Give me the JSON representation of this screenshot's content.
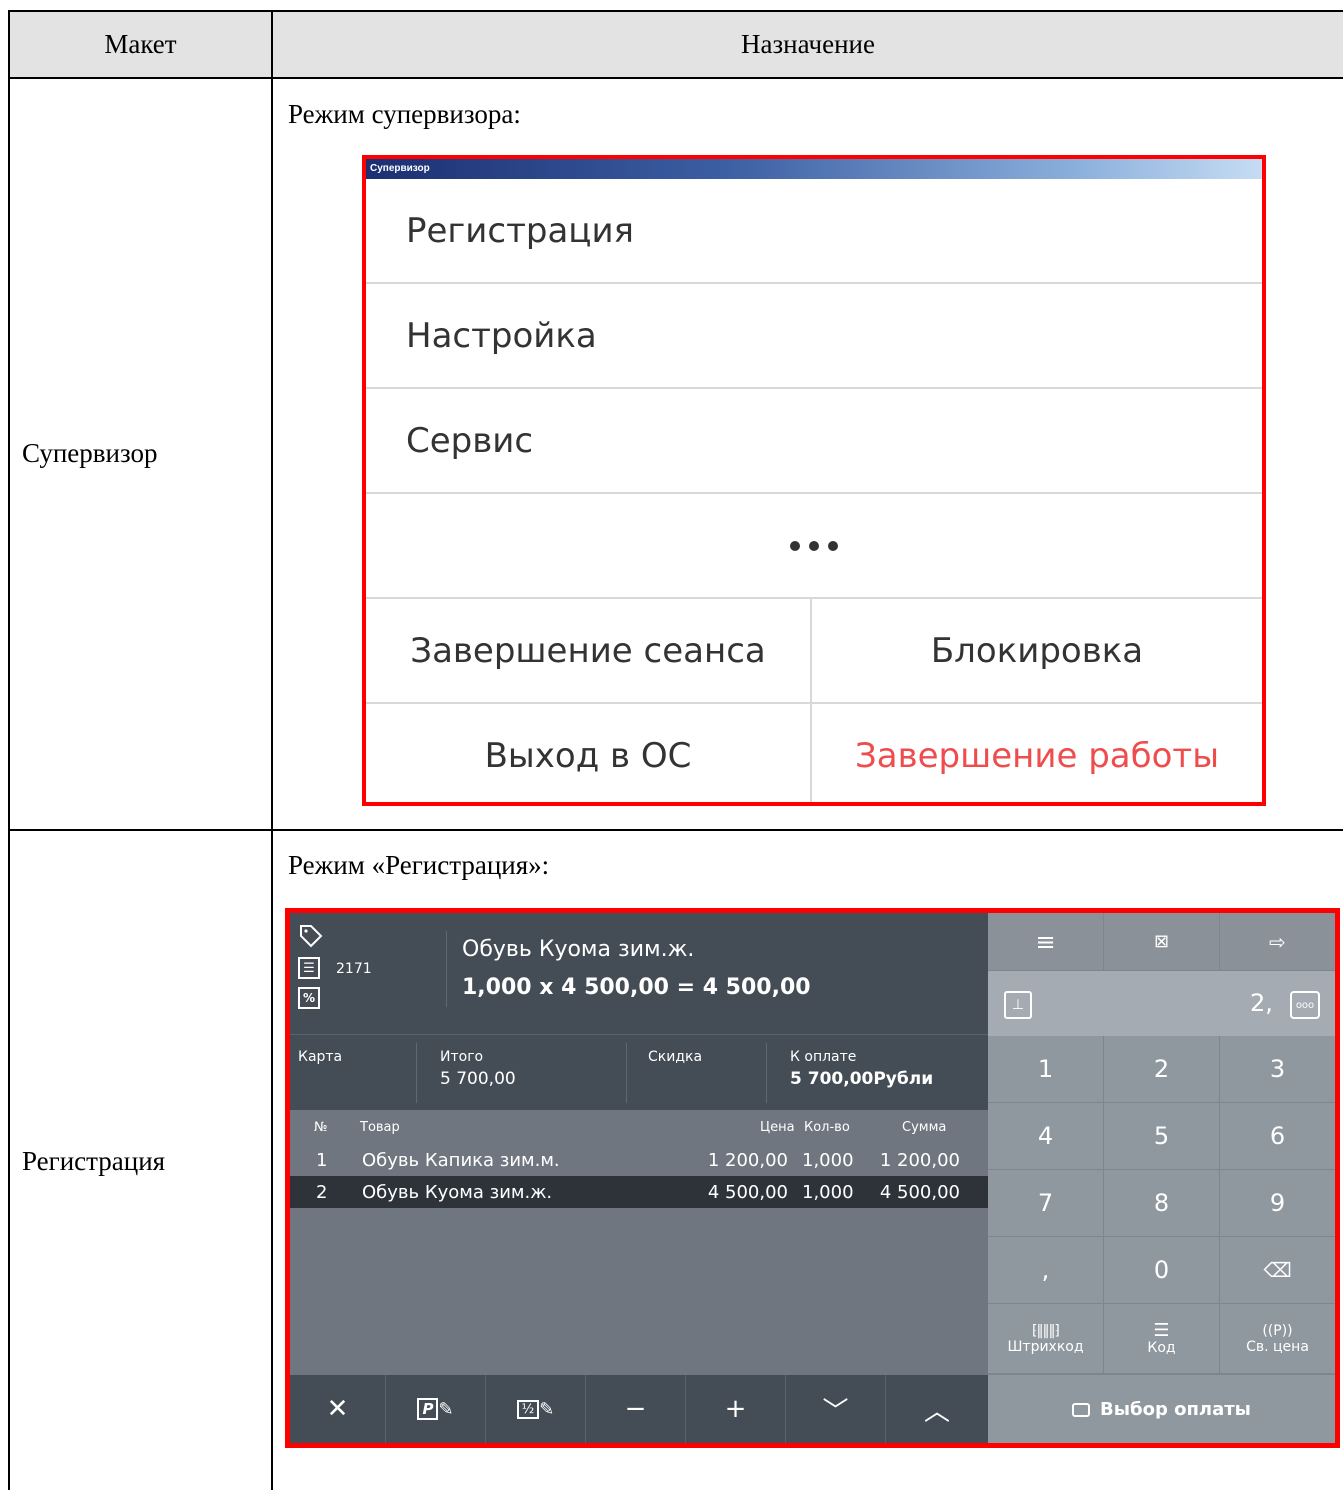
{
  "table": {
    "header": {
      "col1": "Макет",
      "col2": "Назначение"
    },
    "rows": [
      {
        "name": "Супервизор",
        "caption": "Режим супервизора:"
      },
      {
        "name": "Регистрация",
        "caption": "Режим «Регистрация»:"
      }
    ]
  },
  "supervisor": {
    "title": "Супервизор",
    "items": [
      "Регистрация",
      "Настройка",
      "Сервис"
    ],
    "more_icon": "ellipsis-icon",
    "buttons": {
      "logout": "Завершение сеанса",
      "lock": "Блокировка",
      "exit_os": "Выход в ОС",
      "shutdown": "Завершение работы"
    },
    "shutdown_color": "#ef4d4d"
  },
  "registration": {
    "code": "2171",
    "item_name": "Обувь Куома зим.ж.",
    "item_calc": "1,000 x 4 500,00 = 4 500,00",
    "summary": {
      "card_label": "Карта",
      "total_label": "Итого",
      "total_value": "5 700,00",
      "discount_label": "Скидка",
      "pay_label": "К оплате",
      "pay_value": "5 700,00Рубли"
    },
    "columns": {
      "num": "№",
      "item": "Товар",
      "price": "Цена",
      "qty": "Кол-во",
      "sum": "Сумма"
    },
    "rows": [
      {
        "num": "1",
        "item": "Обувь Капика зим.м.",
        "price": "1 200,00",
        "qty": "1,000",
        "sum": "1 200,00"
      },
      {
        "num": "2",
        "item": "Обувь Куома зим.ж.",
        "price": "4 500,00",
        "qty": "1,000",
        "sum": "4 500,00"
      }
    ],
    "input_value": "2,",
    "keys": [
      "1",
      "2",
      "3",
      "4",
      "5",
      "6",
      "7",
      "8",
      "9",
      ",",
      "0"
    ],
    "func_keys": {
      "barcode": "Штрихкод",
      "code": "Код",
      "free_price": "Св. цена"
    },
    "pay_button": "Выбор оплаты",
    "toolbar_icons": [
      "close-icon",
      "price-edit-icon",
      "qty-edit-icon",
      "minus-icon",
      "plus-icon",
      "chevron-down-icon",
      "chevron-up-icon"
    ]
  }
}
